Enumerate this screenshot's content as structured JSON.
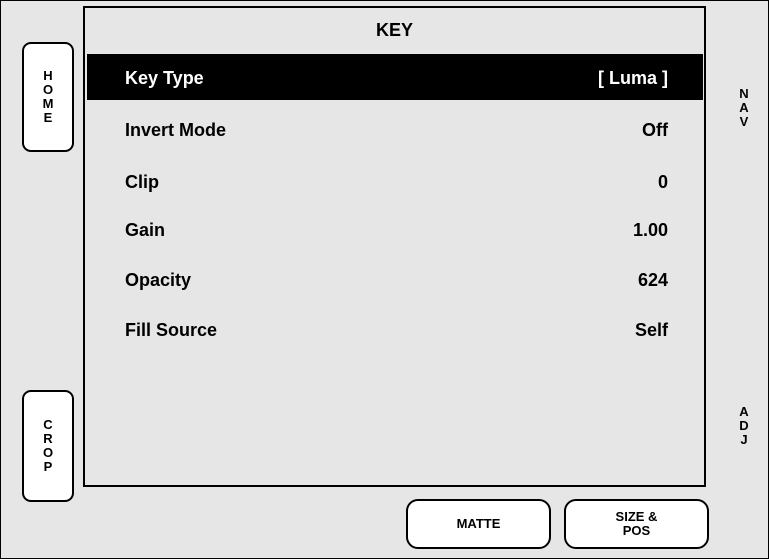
{
  "panel": {
    "title": "KEY"
  },
  "side_buttons": {
    "home": [
      "H",
      "O",
      "M",
      "E"
    ],
    "crop": [
      "C",
      "R",
      "O",
      "P"
    ]
  },
  "side_labels": {
    "nav": [
      "N",
      "A",
      "V"
    ],
    "adj": [
      "A",
      "D",
      "J"
    ]
  },
  "menu": {
    "selected_index": 0,
    "items": [
      {
        "label": "Key Type",
        "value": "[ Luma ]"
      },
      {
        "label": "Invert Mode",
        "value": "Off"
      },
      {
        "label": "Clip",
        "value": "0"
      },
      {
        "label": "Gain",
        "value": "1.00"
      },
      {
        "label": "Opacity",
        "value": "624"
      },
      {
        "label": "Fill Source",
        "value": "Self"
      }
    ]
  },
  "bottom_buttons": {
    "matte": [
      "MATTE"
    ],
    "size_pos": [
      "SIZE &",
      "POS"
    ]
  },
  "colors": {
    "background": "#e6e6e6",
    "selected_row": "#000000",
    "button_face": "#ffffff"
  }
}
